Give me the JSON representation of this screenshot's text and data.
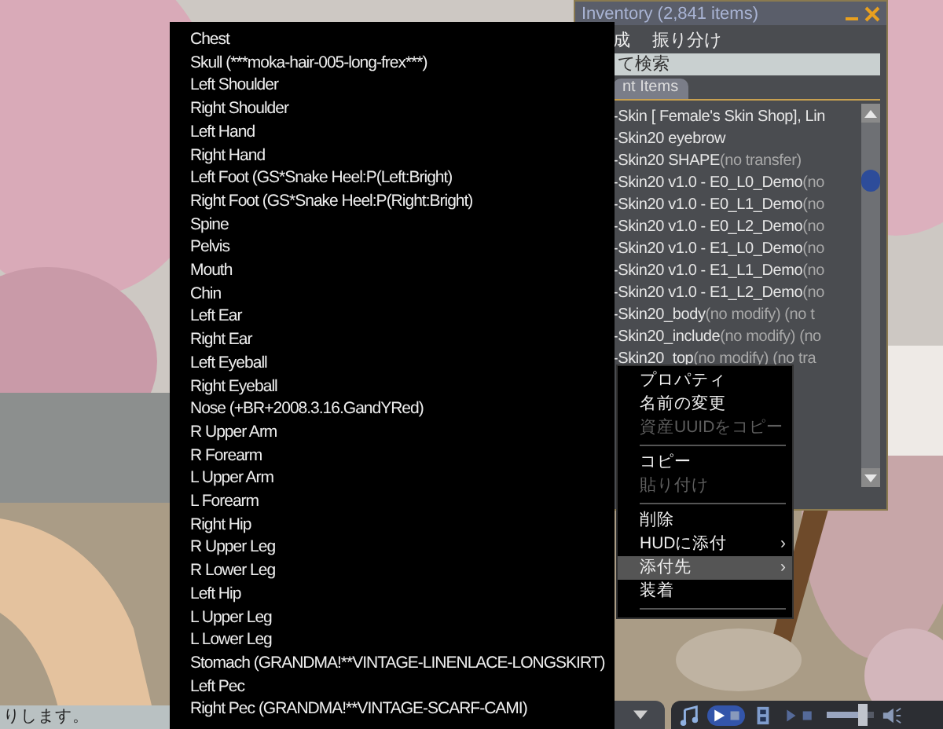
{
  "inventory": {
    "title": "Inventory (2,841 items)",
    "menu": [
      "成",
      "振り分け"
    ],
    "search": {
      "placeholder": "て検索"
    },
    "tabs": [
      {
        "label": "nt Items",
        "selected": true
      }
    ],
    "items": [
      {
        "name": "-Skin [ Female's Skin Shop], Lin"
      },
      {
        "name": "-Skin20 eyebrow"
      },
      {
        "name": "-Skin20 SHAPE",
        "note": "(no transfer)"
      },
      {
        "name": "-Skin20 v1.0 - E0_L0_Demo",
        "note": "(no"
      },
      {
        "name": "-Skin20 v1.0 - E0_L1_Demo",
        "note": "(no"
      },
      {
        "name": "-Skin20 v1.0 - E0_L2_Demo",
        "note": "(no"
      },
      {
        "name": "-Skin20 v1.0 - E1_L0_Demo",
        "note": "(no"
      },
      {
        "name": "-Skin20 v1.0 - E1_L1_Demo",
        "note": "(no"
      },
      {
        "name": "-Skin20 v1.0 - E1_L2_Demo",
        "note": "(no"
      },
      {
        "name": "-Skin20_body",
        "note": "(no modify) (no t"
      },
      {
        "name": "-Skin20_include",
        "note": "(no modify) (no"
      },
      {
        "name": "-Skin20_top",
        "note": "(no modify) (no tra"
      }
    ]
  },
  "attach_menu": {
    "items": [
      "Chest",
      "Skull (***moka-hair-005-long-frex***)",
      "Left Shoulder",
      "Right Shoulder",
      "Left Hand",
      "Right Hand",
      "Left Foot (GS*Snake Heel:P(Left:Bright)",
      "Right Foot (GS*Snake Heel:P(Right:Bright)",
      "Spine",
      "Pelvis",
      "Mouth",
      "Chin",
      "Left Ear",
      "Right Ear",
      "Left Eyeball",
      "Right Eyeball",
      "Nose (+BR+2008.3.16.GandYRed)",
      "R Upper Arm",
      "R Forearm",
      "L Upper Arm",
      "L Forearm",
      "Right Hip",
      "R Upper Leg",
      "R Lower Leg",
      "Left Hip",
      "L Upper Leg",
      "L Lower Leg",
      "Stomach (GRANDMA!**VINTAGE-LINENLACE-LONGSKIRT)",
      "Left Pec",
      "Right Pec (GRANDMA!**VINTAGE-SCARF-CAMI)"
    ]
  },
  "context_menu": {
    "items": [
      {
        "kind": "item",
        "label": "プロパティ",
        "disabled": false,
        "selected": false
      },
      {
        "kind": "item",
        "label": "名前の変更",
        "disabled": false,
        "selected": false
      },
      {
        "kind": "item",
        "label": "資産UUIDをコピー",
        "disabled": true,
        "selected": false
      },
      {
        "kind": "separator"
      },
      {
        "kind": "item",
        "label": "コピー",
        "disabled": false,
        "selected": false
      },
      {
        "kind": "item",
        "label": "貼り付け",
        "disabled": true,
        "selected": false
      },
      {
        "kind": "separator"
      },
      {
        "kind": "item",
        "label": "削除",
        "disabled": false,
        "selected": false
      },
      {
        "kind": "item",
        "label": "HUDに添付",
        "disabled": false,
        "selected": false,
        "arrow": "›"
      },
      {
        "kind": "item",
        "label": "添付先",
        "disabled": false,
        "selected": true,
        "arrow": "›"
      },
      {
        "kind": "item",
        "label": "装着",
        "disabled": false,
        "selected": false
      },
      {
        "kind": "separator"
      }
    ]
  },
  "status_bar": {
    "text": "りします。"
  },
  "media_bar": {
    "volume": {
      "level": 0.75
    }
  }
}
